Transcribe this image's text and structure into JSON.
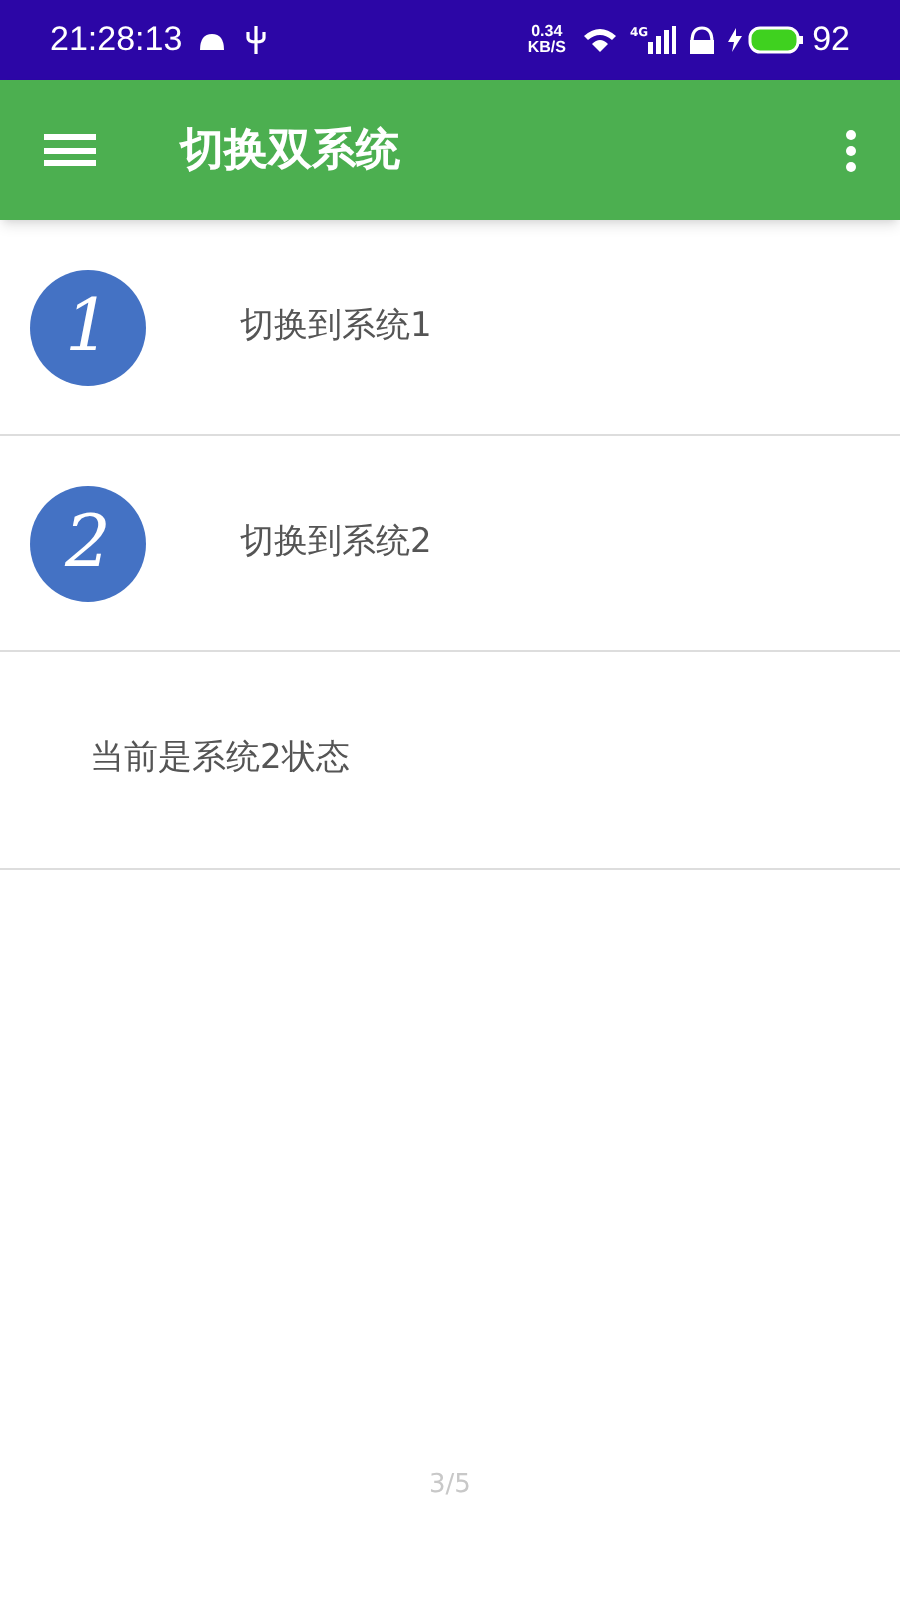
{
  "status_bar": {
    "time": "21:28:13",
    "net_speed_value": "0.34",
    "net_speed_unit": "KB/S",
    "network_type": "4G",
    "battery": "92"
  },
  "app_bar": {
    "title": "切换双系统"
  },
  "options": [
    {
      "number": "1",
      "label": "切换到系统1"
    },
    {
      "number": "2",
      "label": "切换到系统2"
    }
  ],
  "status_text": "当前是系统2状态",
  "page_indicator": "3/5"
}
